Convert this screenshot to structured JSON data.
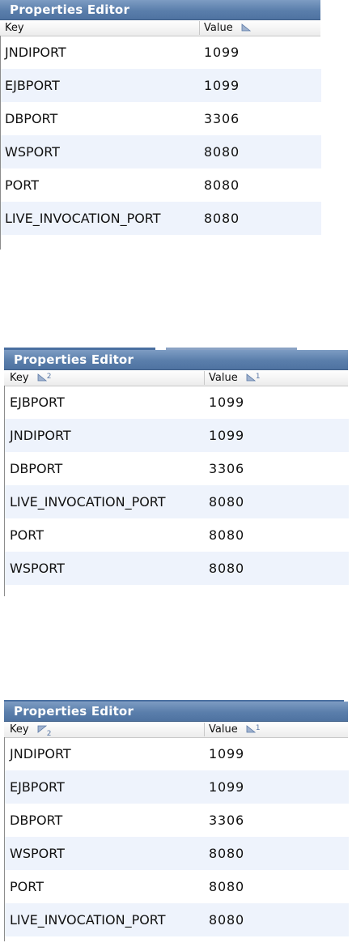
{
  "panels": [
    {
      "title": "Properties Editor",
      "columns": [
        "Key",
        "Value"
      ],
      "key_sort_rank": "",
      "value_sort_rank": "",
      "key_sort_icon": "",
      "value_sort_icon": "sort-ascending-icon",
      "rows": [
        {
          "key": "JNDIPORT",
          "value": "1099"
        },
        {
          "key": "EJBPORT",
          "value": "1099"
        },
        {
          "key": "DBPORT",
          "value": "3306"
        },
        {
          "key": "WSPORT",
          "value": "8080"
        },
        {
          "key": "PORT",
          "value": "8080"
        },
        {
          "key": "LIVE_INVOCATION_PORT",
          "value": "8080"
        }
      ]
    },
    {
      "title": "Properties Editor",
      "columns": [
        "Key",
        "Value"
      ],
      "key_sort_rank": "2",
      "value_sort_rank": "1",
      "key_sort_icon": "sort-ascending-icon",
      "value_sort_icon": "sort-ascending-icon",
      "rows": [
        {
          "key": "EJBPORT",
          "value": "1099"
        },
        {
          "key": "JNDIPORT",
          "value": "1099"
        },
        {
          "key": "DBPORT",
          "value": "3306"
        },
        {
          "key": "LIVE_INVOCATION_PORT",
          "value": "8080"
        },
        {
          "key": "PORT",
          "value": "8080"
        },
        {
          "key": "WSPORT",
          "value": "8080"
        }
      ]
    },
    {
      "title": "Properties Editor",
      "columns": [
        "Key",
        "Value"
      ],
      "key_sort_rank": "2",
      "value_sort_rank": "1",
      "key_sort_icon": "sort-descending-icon",
      "value_sort_icon": "sort-ascending-icon",
      "rows": [
        {
          "key": "JNDIPORT",
          "value": "1099"
        },
        {
          "key": "EJBPORT",
          "value": "1099"
        },
        {
          "key": "DBPORT",
          "value": "3306"
        },
        {
          "key": "WSPORT",
          "value": "8080"
        },
        {
          "key": "PORT",
          "value": "8080"
        },
        {
          "key": "LIVE_INVOCATION_PORT",
          "value": "8080"
        }
      ]
    }
  ],
  "colors": {
    "title_bar": "#5a7eab",
    "alt_row": "#eef3fc",
    "sort_icon": "#5b79a6"
  }
}
